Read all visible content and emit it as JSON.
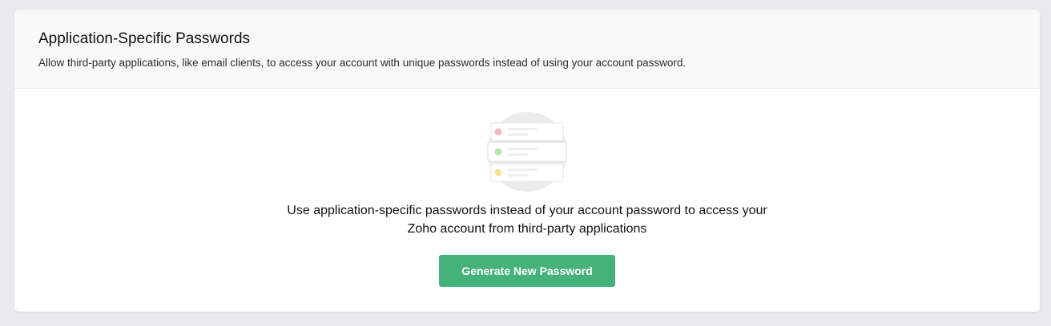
{
  "section": {
    "title": "Application-Specific Passwords",
    "description": "Allow third-party applications, like email clients, to access your account with unique passwords instead of using your account password."
  },
  "empty_state": {
    "illustration_icon": "password-list-illustration",
    "message_line1": "Use application-specific passwords instead of your account password to access your",
    "message_line2": "Zoho account from third-party applications",
    "button_label": "Generate New Password"
  },
  "colors": {
    "button": "#44b27a",
    "dot_red": "#f2b8c0",
    "dot_green": "#b7e3b0",
    "dot_yellow": "#f8e48e"
  }
}
